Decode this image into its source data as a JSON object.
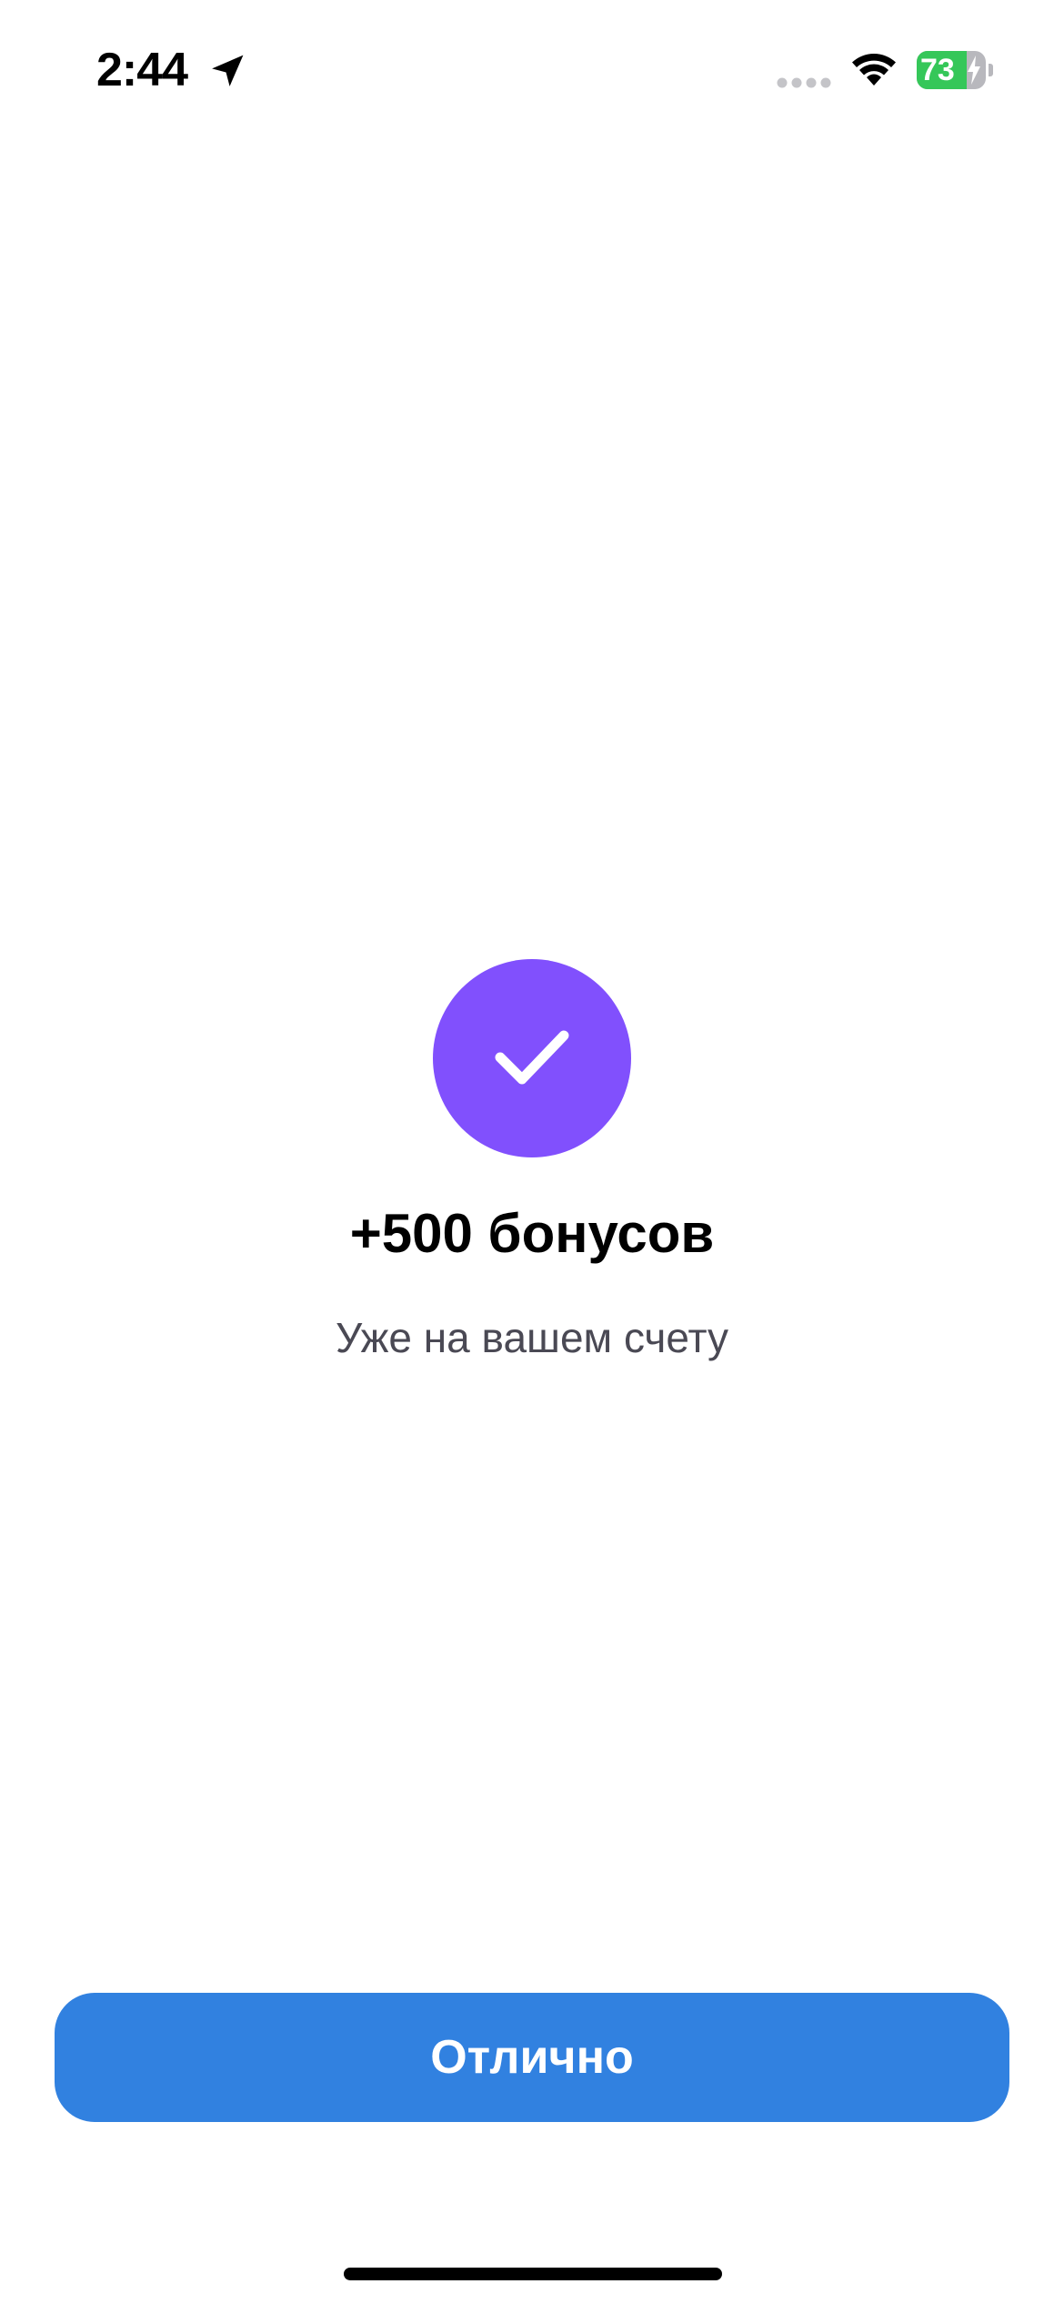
{
  "status_bar": {
    "time": "2:44",
    "battery_percent": "73",
    "battery_level": 0.73,
    "icons": [
      "location-arrow-icon",
      "signal-icon",
      "wifi-icon",
      "battery-charging-icon"
    ]
  },
  "success": {
    "icon": "checkmark-icon",
    "title": "+500 бонусов",
    "subtitle": "Уже на вашем счету"
  },
  "actions": {
    "confirm_label": "Отлично"
  },
  "colors": {
    "accent_purple": "#8150FD",
    "button_blue": "#3181E0",
    "subtitle_gray": "#4A4954",
    "battery_green": "#35C759"
  }
}
